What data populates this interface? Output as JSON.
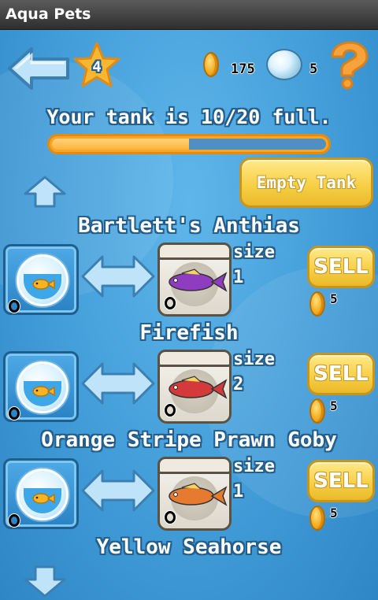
{
  "app": {
    "title": "Aqua Pets"
  },
  "header": {
    "level": "4",
    "coins": "175",
    "pearls": "5"
  },
  "tank": {
    "status_text": "Your tank is 10/20 full.",
    "fill_fraction": 0.5,
    "empty_button": "Empty Tank"
  },
  "fish": [
    {
      "name": "Bartlett's Anthias",
      "size_label": "size",
      "size": "1",
      "bowl_count": "0",
      "cage_count": "0",
      "sell_label": "SELL",
      "price": "5",
      "color": "#8f3cc0"
    },
    {
      "name": "Firefish",
      "size_label": "size",
      "size": "2",
      "bowl_count": "0",
      "cage_count": "0",
      "sell_label": "SELL",
      "price": "5",
      "color": "#d43a3a"
    },
    {
      "name": "Orange Stripe Prawn Goby",
      "size_label": "size",
      "size": "1",
      "bowl_count": "0",
      "cage_count": "0",
      "sell_label": "SELL",
      "price": "5",
      "color": "#e67a2e"
    },
    {
      "name": "Yellow Seahorse"
    }
  ],
  "icons": {
    "back": "back-arrow-icon",
    "level": "star-icon",
    "coin": "coin-icon",
    "pearl": "pearl-icon",
    "help": "question-mark-icon",
    "scroll_up": "up-arrow-icon",
    "scroll_down": "down-arrow-icon",
    "bowl": "fishbowl-icon",
    "transfer": "left-right-arrow-icon",
    "cage": "holding-cage-icon"
  }
}
